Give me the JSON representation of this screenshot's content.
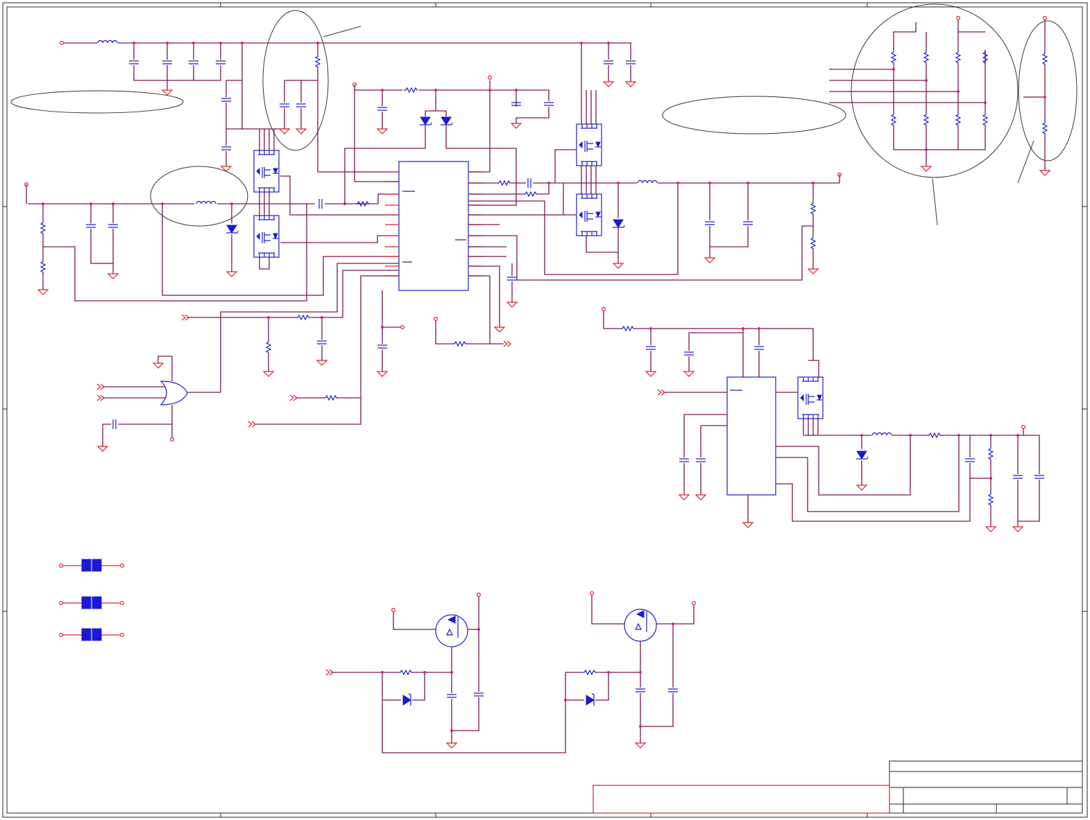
{
  "sheet": {
    "title_block": {
      "title": "",
      "fields": []
    },
    "colors": {
      "wire": "#7a1550",
      "net": "#e0202a",
      "component": "#1a1ad0",
      "junction": "#d0208a",
      "frame": "#222222"
    },
    "regions": [
      "main-controller-block",
      "upper-mosfet-pair-left",
      "upper-mosfet-pair-right",
      "output-filter-right",
      "resistor-network-top-right",
      "secondary-regulator-block",
      "or-gate-logic",
      "pmos-switch-left",
      "pmos-switch-right",
      "jumper-links"
    ],
    "icons": {
      "capacitor": "capacitor-icon",
      "resistor": "resistor-icon",
      "inductor": "inductor-icon",
      "ground": "ground-icon",
      "mosfet": "mosfet-icon",
      "diode": "diode-icon",
      "zener": "zener-diode-icon",
      "or_gate": "or-gate-icon",
      "port": "port-arrow-icon",
      "jumper": "jumper-icon"
    }
  }
}
